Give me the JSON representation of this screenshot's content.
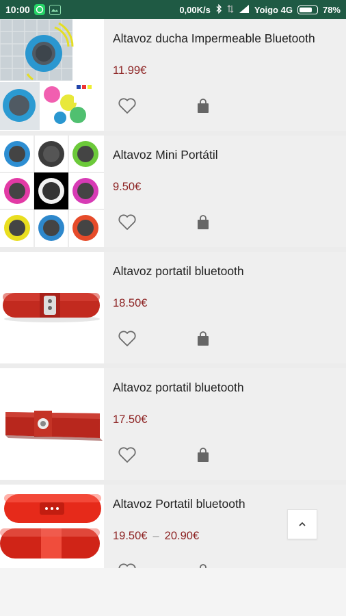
{
  "status_bar": {
    "time": "10:00",
    "network_speed": "0,00K/s",
    "carrier": "Yoigo 4G",
    "battery": "78%",
    "battery_level": 0.78,
    "icons": [
      "whatsapp-icon",
      "gallery-icon",
      "bluetooth-icon",
      "data-arrows-icon",
      "signal-icon",
      "battery-icon"
    ]
  },
  "products": [
    {
      "title": "Altavoz ducha Impermeable Bluetooth",
      "price": "11.99€",
      "price_max": null,
      "image": "shower-speaker-image"
    },
    {
      "title": "Altavoz Mini Portátil",
      "price": "9.50€",
      "price_max": null,
      "image": "mini-speakers-grid-image"
    },
    {
      "title": "Altavoz portatil bluetooth",
      "price": "18.50€",
      "price_max": null,
      "image": "pill-speaker-image"
    },
    {
      "title": "Altavoz portatil bluetooth",
      "price": "17.50€",
      "price_max": null,
      "image": "bar-speaker-image"
    },
    {
      "title": "Altavoz Portatil bluetooth",
      "price": "19.50€",
      "price_dash": "–",
      "price_max": "20.90€",
      "image": "red-pill-speakers-image"
    }
  ],
  "actions": {
    "wishlist_icon": "heart-outline-icon",
    "cart_icon": "shopping-bag-icon",
    "scroll_top_icon": "chevron-up-icon"
  },
  "colors": {
    "status_bar": "#1f5a44",
    "price": "#8d2323",
    "card_info_bg": "#efefef"
  }
}
